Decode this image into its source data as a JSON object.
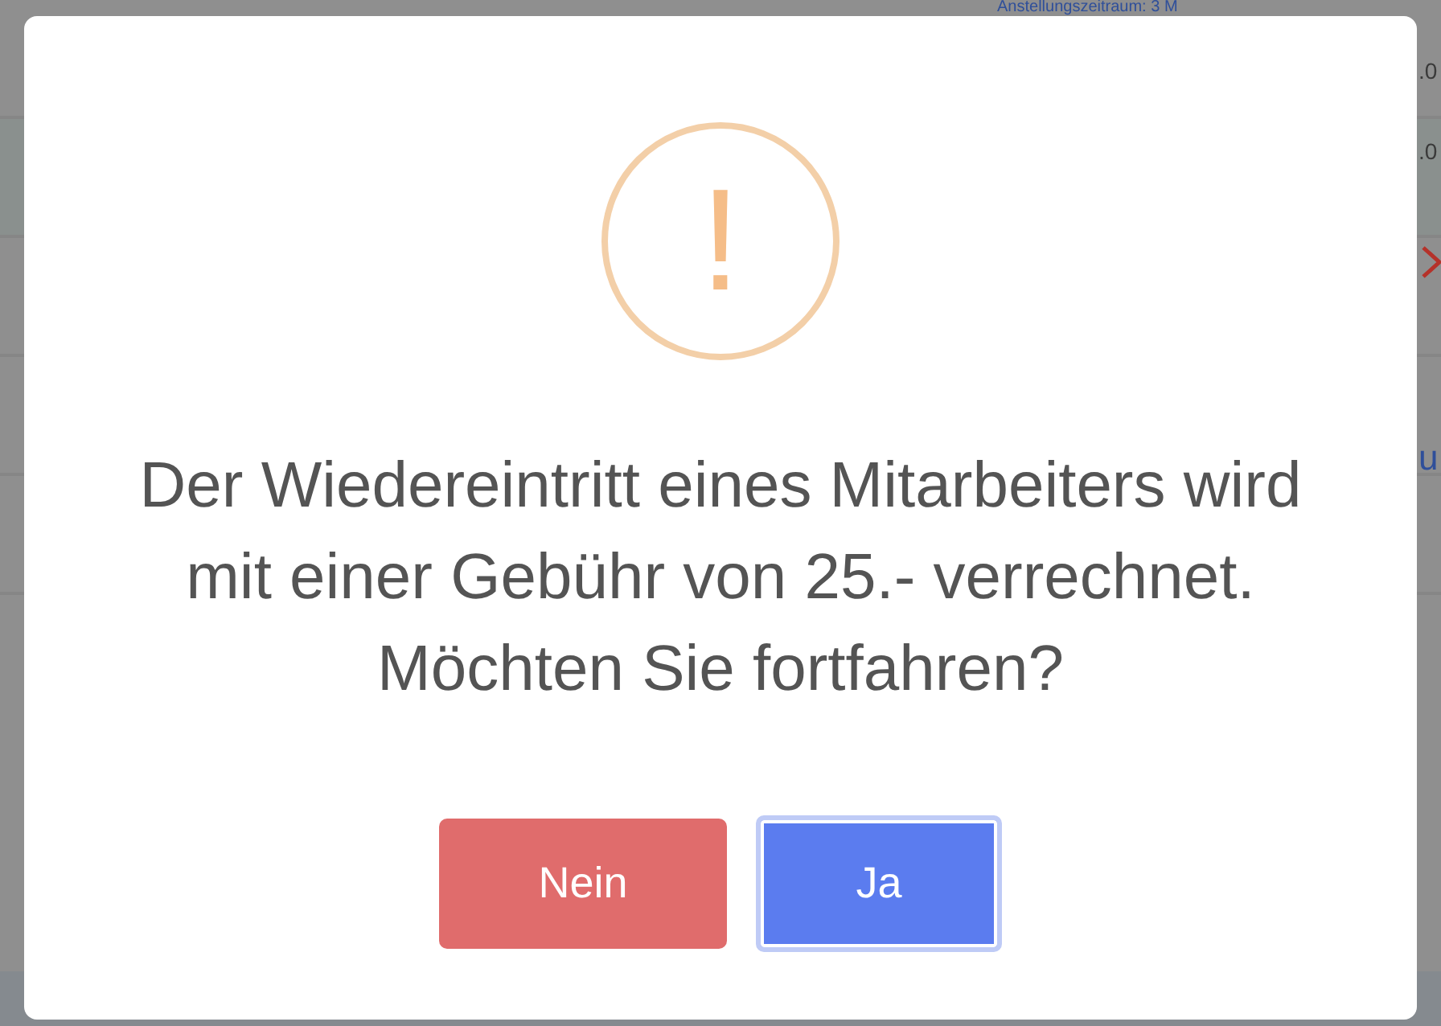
{
  "background": {
    "header_text": "Anstellungszeitraum: 3 M",
    "cells": [
      ".0",
      ".0"
    ],
    "link_fragment": "u"
  },
  "dialog": {
    "icon": "!",
    "message": "Der Wiedereintritt eines Mitarbeiters wird mit einer Gebühr von 25.- verrechnet.",
    "question": "Möchten Sie fortfahren?",
    "buttons": [
      {
        "label": "Nein",
        "kind": "cancel",
        "focused": false
      },
      {
        "label": "Ja",
        "kind": "confirm",
        "focused": true
      }
    ]
  }
}
